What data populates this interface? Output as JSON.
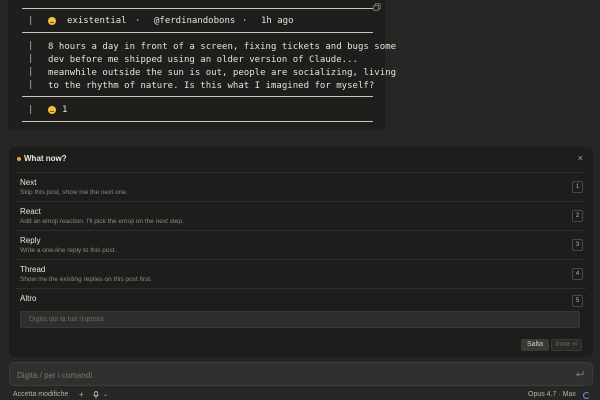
{
  "post": {
    "mood": "existential",
    "separator": "·",
    "author": "@ferdinandobons",
    "time": "1h ago",
    "body_lines": [
      "8 hours a day in front of a screen, fixing tickets and bugs some",
      "dev before me shipped using an older version of Claude...",
      "meanwhile outside the sun is out, people are socializing, living",
      "to the rhythm of nature. Is this what I imagined for myself?"
    ],
    "reaction_count": "1",
    "bar_char": "|",
    "icons": {
      "mood": "thinking-face-emoji",
      "reaction": "grimace-emoji",
      "copy": "copy-icon"
    }
  },
  "question": {
    "title": "What now?",
    "close_label": "×",
    "options": [
      {
        "label": "Next",
        "description": "Skip this post, show me the next one.",
        "key": "1"
      },
      {
        "label": "React",
        "description": "Add an emoji reaction. I'll pick the emoji on the next step.",
        "key": "2"
      },
      {
        "label": "Reply",
        "description": "Write a one-line reply to this post.",
        "key": "3"
      },
      {
        "label": "Thread",
        "description": "Show me the existing replies on this post first.",
        "key": "4"
      },
      {
        "label": "Altro",
        "description": "",
        "key": "5"
      }
    ],
    "other_placeholder": "Digita qui la tua risposta",
    "skip_label": "Salta",
    "send_label": "Invia ⏎"
  },
  "composer": {
    "placeholder": "Digita / per i comandi",
    "submit_icon": "enter-icon"
  },
  "footer": {
    "accept_label": "Accetta modifiche",
    "add_icon": "+",
    "mic_icon": "mic-icon",
    "chevron_icon": "⌄",
    "model_label": "Opus 4.7 · Max"
  },
  "colors": {
    "background": "#262624",
    "panel": "#1d1d1b",
    "accent_dot": "#e0a83a",
    "spinner": "#6c8fd6"
  }
}
